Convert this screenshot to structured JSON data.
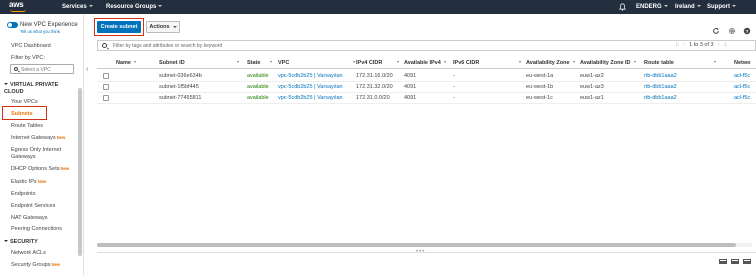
{
  "nav": {
    "logo": "aws",
    "services": "Services",
    "resource_groups": "Resource Groups",
    "account": "ENDERG",
    "region": "Ireland",
    "support": "Support"
  },
  "sidebar": {
    "new_vpc_experience": "New VPC Experience",
    "tell_us": "Tell us what you think",
    "vpc_dashboard": "VPC Dashboard",
    "filter_by_vpc": "Filter by VPC:",
    "select_vpc_placeholder": "Select a VPC",
    "section_vpc": "VIRTUAL PRIVATE CLOUD",
    "items_vpc": [
      {
        "label": "Your VPCs",
        "new": ""
      },
      {
        "label": "Subnets",
        "new": ""
      },
      {
        "label": "Route Tables",
        "new": ""
      },
      {
        "label": "Internet Gateways",
        "new": "New"
      },
      {
        "label": "Egress Only Internet Gateways",
        "new": ""
      },
      {
        "label": "DHCP Options Sets",
        "new": "New"
      },
      {
        "label": "Elastic IPs",
        "new": "New"
      },
      {
        "label": "Endpoints",
        "new": ""
      },
      {
        "label": "Endpoint Services",
        "new": ""
      },
      {
        "label": "NAT Gateways",
        "new": ""
      },
      {
        "label": "Peering Connections",
        "new": ""
      }
    ],
    "section_security": "SECURITY",
    "items_security": [
      {
        "label": "Network ACLs",
        "new": ""
      },
      {
        "label": "Security Groups",
        "new": "New"
      }
    ],
    "active_item": "Subnets"
  },
  "toolbar": {
    "create_label": "Create subnet",
    "actions_label": "Actions",
    "icons": [
      "refresh-icon",
      "settings-icon",
      "help-icon"
    ]
  },
  "filter": {
    "placeholder": "Filter by tags and attributes or search by keyword",
    "pager_text": "1 to 3 of 3"
  },
  "table": {
    "columns": [
      "Name",
      "Subnet ID",
      "State",
      "VPC",
      "IPv4 CIDR",
      "Available IPv4",
      "IPv6 CIDR",
      "Availability Zone",
      "Availability Zone ID",
      "Route table",
      "Netwo"
    ],
    "rows": [
      {
        "name": "",
        "subnet_id": "subnet-036e634b",
        "state": "available",
        "vpc": "vpc-5cdb2b25 | Varsayılan",
        "ipv4": "172.31.16.0/20",
        "avail": "4091",
        "ipv6": "-",
        "az": "eu-west-1a",
        "azid": "euw1-az2",
        "rtb": "rtb-dbb1aaa2",
        "acl": "acl-f5c"
      },
      {
        "name": "",
        "subnet_id": "subnet-1f5bf445",
        "state": "available",
        "vpc": "vpc-5cdb2b25 | Varsayılan",
        "ipv4": "172.31.32.0/20",
        "avail": "4091",
        "ipv6": "-",
        "az": "eu-west-1b",
        "azid": "euw1-az3",
        "rtb": "rtb-dbb1aaa2",
        "acl": "acl-f5c"
      },
      {
        "name": "",
        "subnet_id": "subnet-77455811",
        "state": "available",
        "vpc": "vpc-5cdb2b25 | Varsayılan",
        "ipv4": "172.31.0.0/20",
        "avail": "4091",
        "ipv6": "-",
        "az": "eu-west-1c",
        "azid": "euw1-az1",
        "rtb": "rtb-dbb1aaa2",
        "acl": "acl-f5c"
      }
    ]
  },
  "colors": {
    "nav_bg": "#232f3e",
    "primary_button": "#0073bb",
    "highlight_box": "#d13212",
    "status_available": "#1d8102",
    "new_badge": "#e47911"
  }
}
